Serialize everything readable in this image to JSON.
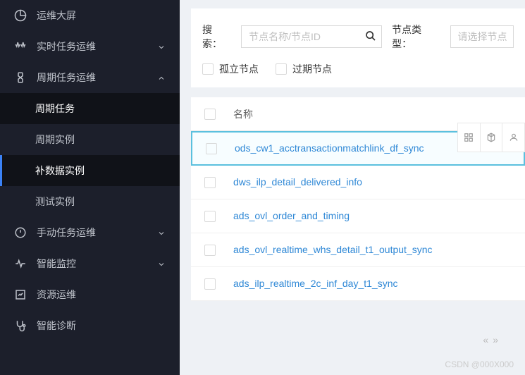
{
  "sidebar": {
    "items": [
      {
        "label": "运维大屏"
      },
      {
        "label": "实时任务运维"
      },
      {
        "label": "周期任务运维"
      },
      {
        "label": "周期任务"
      },
      {
        "label": "周期实例"
      },
      {
        "label": "补数据实例"
      },
      {
        "label": "测试实例"
      },
      {
        "label": "手动任务运维"
      },
      {
        "label": "智能监控"
      },
      {
        "label": "资源运维"
      },
      {
        "label": "智能诊断"
      }
    ]
  },
  "filter": {
    "search_label": "搜索：",
    "search_placeholder": "节点名称/节点ID",
    "type_label": "节点类型：",
    "type_placeholder": "请选择节点",
    "isolated": "孤立节点",
    "expired": "过期节点"
  },
  "table": {
    "head_name": "名称",
    "rows": [
      {
        "name": "ods_cw1_acctransactionmatchlink_df_sync"
      },
      {
        "name": "dws_ilp_detail_delivered_info"
      },
      {
        "name": "ads_ovl_order_and_timing"
      },
      {
        "name": "ads_ovl_realtime_whs_detail_t1_output_sync"
      },
      {
        "name": "ads_ilp_realtime_2c_inf_day_t1_sync"
      }
    ]
  },
  "watermark": "CSDN @000X000"
}
